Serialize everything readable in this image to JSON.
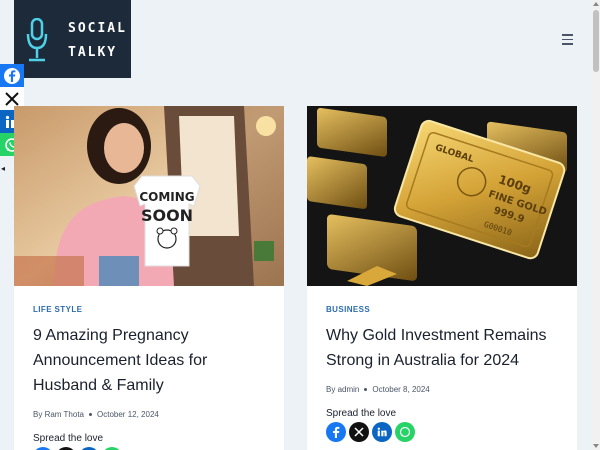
{
  "site": {
    "logo_line1": "SOCIAL",
    "logo_line2": "TALKY",
    "logo_icon": "microphone-icon",
    "menu_icon": "hamburger-menu-icon"
  },
  "share_bar": {
    "items": [
      "facebook-icon",
      "x-icon",
      "linkedin-icon",
      "whatsapp-icon"
    ],
    "toggle_glyph": "◂"
  },
  "posts": [
    {
      "category": "LIFE STYLE",
      "title": "9 Amazing Pregnancy Announcement Ideas for Husband & Family",
      "by_label": "By",
      "author": "Ram Thota",
      "date": "October 12, 2024",
      "spread_label": "Spread the love",
      "image_onesie_line1": "COMING",
      "image_onesie_line2": "SOON"
    },
    {
      "category": "BUSINESS",
      "title": "Why Gold Investment Remains Strong in Australia for 2024",
      "by_label": "By",
      "author": "admin",
      "date": "October 8, 2024",
      "spread_label": "Spread the love",
      "image_bar_text1": "GLOBAL",
      "image_bar_text2": "100g",
      "image_bar_text3": "FINE GOLD",
      "image_bar_text4": "999.9",
      "image_bar_text5": "G00010"
    }
  ],
  "colors": {
    "logo_bg": "#1d2a3a",
    "accent": "#2b6cb0",
    "facebook": "#1877f2",
    "linkedin": "#0a66c2",
    "whatsapp": "#25d366",
    "x": "#111111"
  }
}
